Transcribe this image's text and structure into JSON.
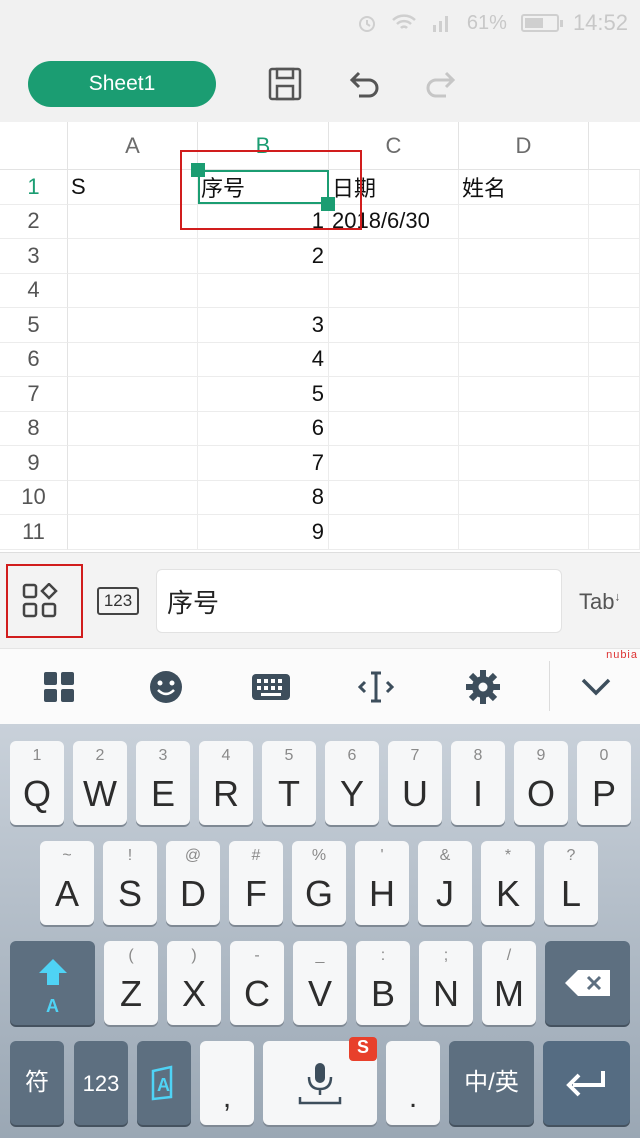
{
  "status_bar": {
    "battery_percent": "61%",
    "battery_level": 0.61,
    "time": "14:52"
  },
  "toolbar": {
    "sheet_name": "Sheet1"
  },
  "sheet": {
    "columns": [
      "A",
      "B",
      "C",
      "D"
    ],
    "rows": [
      {
        "num": "1",
        "cells": [
          "S",
          "序号",
          "日期",
          "姓名"
        ]
      },
      {
        "num": "2",
        "cells": [
          "",
          "1",
          "2018/6/30",
          ""
        ]
      },
      {
        "num": "3",
        "cells": [
          "",
          "2",
          "",
          ""
        ]
      },
      {
        "num": "4",
        "cells": [
          "",
          "",
          "",
          ""
        ]
      },
      {
        "num": "5",
        "cells": [
          "",
          "3",
          "",
          ""
        ]
      },
      {
        "num": "6",
        "cells": [
          "",
          "4",
          "",
          ""
        ]
      },
      {
        "num": "7",
        "cells": [
          "",
          "5",
          "",
          ""
        ]
      },
      {
        "num": "8",
        "cells": [
          "",
          "6",
          "",
          ""
        ]
      },
      {
        "num": "9",
        "cells": [
          "",
          "7",
          "",
          ""
        ]
      },
      {
        "num": "10",
        "cells": [
          "",
          "8",
          "",
          ""
        ]
      },
      {
        "num": "11",
        "cells": [
          "",
          "9",
          "",
          ""
        ]
      }
    ],
    "selected_cell": "B1"
  },
  "formula_bar": {
    "keypad_label": "123",
    "value": "序号",
    "tab_label": "Tab"
  },
  "ime_bar": {
    "brand": "nubia"
  },
  "keyboard": {
    "row1": [
      {
        "main": "Q",
        "sub": "1"
      },
      {
        "main": "W",
        "sub": "2"
      },
      {
        "main": "E",
        "sub": "3"
      },
      {
        "main": "R",
        "sub": "4"
      },
      {
        "main": "T",
        "sub": "5"
      },
      {
        "main": "Y",
        "sub": "6"
      },
      {
        "main": "U",
        "sub": "7"
      },
      {
        "main": "I",
        "sub": "8"
      },
      {
        "main": "O",
        "sub": "9"
      },
      {
        "main": "P",
        "sub": "0"
      }
    ],
    "row2": [
      {
        "main": "A",
        "sub": "~"
      },
      {
        "main": "S",
        "sub": "!"
      },
      {
        "main": "D",
        "sub": "@"
      },
      {
        "main": "F",
        "sub": "#"
      },
      {
        "main": "G",
        "sub": "%"
      },
      {
        "main": "H",
        "sub": "'"
      },
      {
        "main": "J",
        "sub": "&"
      },
      {
        "main": "K",
        "sub": "*"
      },
      {
        "main": "L",
        "sub": "?"
      }
    ],
    "row3": [
      {
        "main": "Z",
        "sub": "("
      },
      {
        "main": "X",
        "sub": ")"
      },
      {
        "main": "C",
        "sub": "-"
      },
      {
        "main": "V",
        "sub": "_"
      },
      {
        "main": "B",
        "sub": ":"
      },
      {
        "main": "N",
        "sub": ";"
      },
      {
        "main": "M",
        "sub": "/"
      }
    ],
    "shift_label": "A",
    "symbols_label": "符",
    "numbers_label": "123",
    "comma_label": ",",
    "period_label": ".",
    "lang_label": "中/英"
  },
  "colors": {
    "accent": "#1b9d72",
    "highlight": "#d11d1d"
  }
}
